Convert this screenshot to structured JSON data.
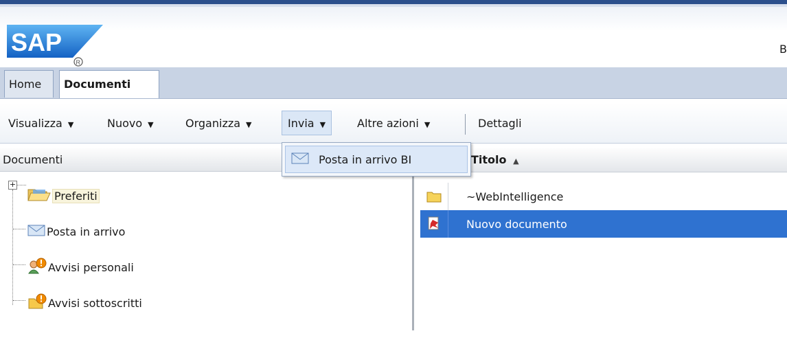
{
  "header": {
    "logo_text": "SAP",
    "right_text": "B"
  },
  "tabs": [
    {
      "label": "Home"
    },
    {
      "label": "Documenti"
    }
  ],
  "toolbar": {
    "visualizza": "Visualizza",
    "nuovo": "Nuovo",
    "organizza": "Organizza",
    "invia": "Invia",
    "altre_azioni": "Altre azioni",
    "dettagli": "Dettagli",
    "dropdown_arrow": "▼"
  },
  "dropdown": {
    "items": [
      {
        "label": "Posta in arrivo BI",
        "icon": "envelope-icon"
      }
    ]
  },
  "left_panel": {
    "header": "Documenti",
    "expand_symbol": "+",
    "items": [
      {
        "label": "Preferiti",
        "icon": "open-folder-icon"
      },
      {
        "label": "Posta in arrivo",
        "icon": "envelope-icon"
      },
      {
        "label": "Avvisi personali",
        "icon": "personal-alert-icon"
      },
      {
        "label": "Avvisi sottoscritti",
        "icon": "subscribed-alert-icon"
      }
    ]
  },
  "right_panel": {
    "column_title": "Titolo",
    "sort_indicator": "▲",
    "rows": [
      {
        "title": "~WebIntelligence",
        "icon": "folder-icon",
        "selected": false
      },
      {
        "title": "Nuovo documento",
        "icon": "webi-document-icon",
        "selected": true
      }
    ]
  },
  "colors": {
    "selection": "#2f72d0",
    "tab_bar": "#c8d3e4",
    "brand_blue": "#1a63c6",
    "alert_orange": "#f08a00"
  }
}
